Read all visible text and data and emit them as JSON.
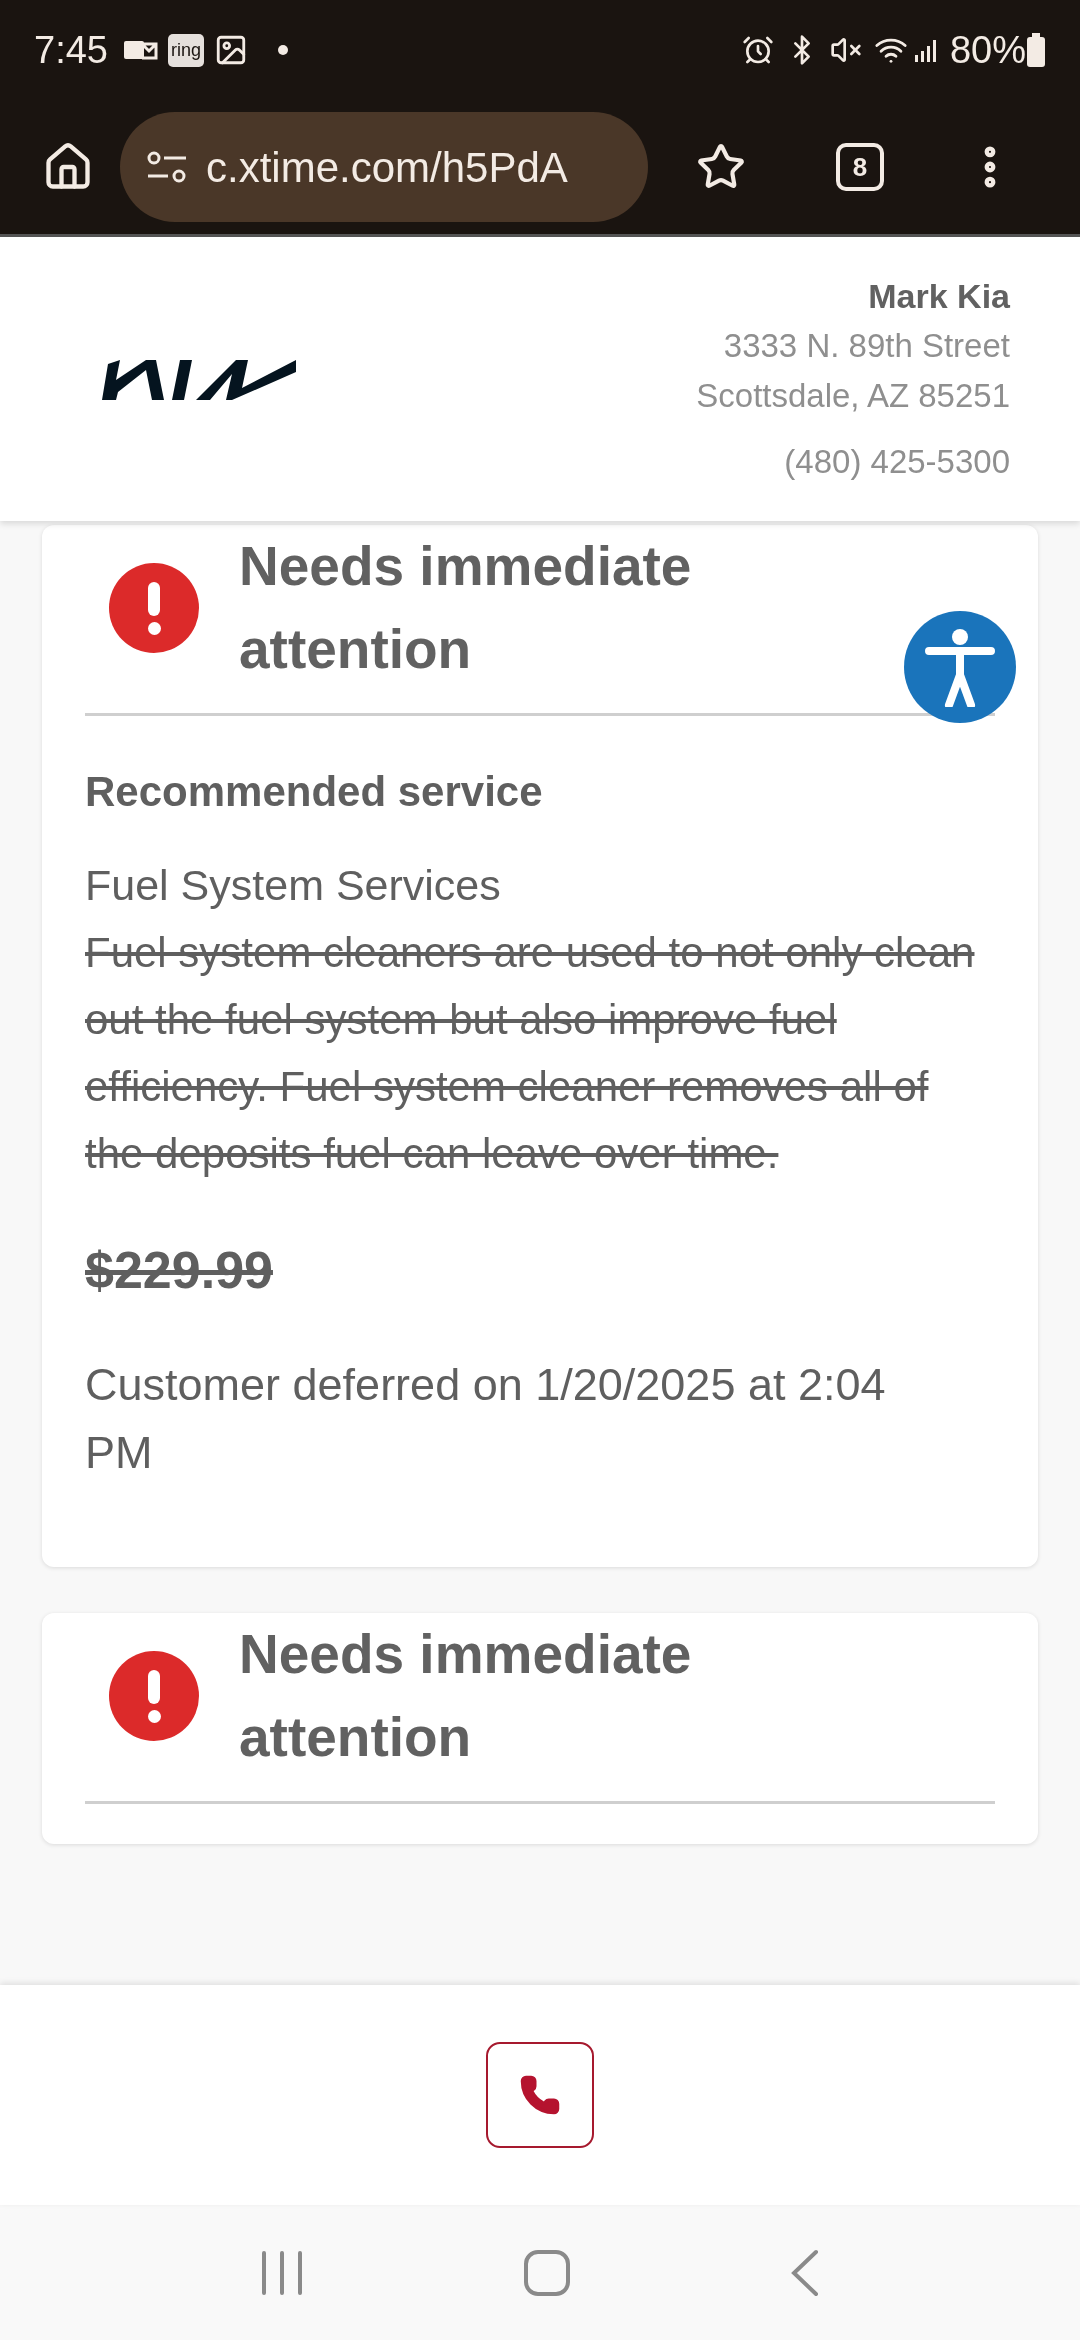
{
  "status_bar": {
    "time": "7:45",
    "ring_badge": "ring",
    "battery": "80%"
  },
  "browser": {
    "url": "c.xtime.com/h5PdA",
    "tab_count": "8"
  },
  "dealer": {
    "name": "Mark Kia",
    "address_lines": [
      "3333 N. 89th Street",
      "Scottsdale, AZ 85251"
    ],
    "phone": "(480) 425-5300"
  },
  "services": [
    {
      "kind": "urgent",
      "heading": "Needs immediate attention",
      "section_label": "Recommended service",
      "name": "Fuel System Services",
      "description": "Fuel system cleaners are used to not only clean out the fuel system but also improve fuel efficiency. Fuel system cleaner removes all of the deposits fuel can leave over time.",
      "declined": true,
      "price": "$229.99",
      "note": "Customer deferred on 1/20/2025 at 2:04 PM"
    },
    {
      "kind": "urgent",
      "heading": "Needs immediate attention"
    }
  ]
}
